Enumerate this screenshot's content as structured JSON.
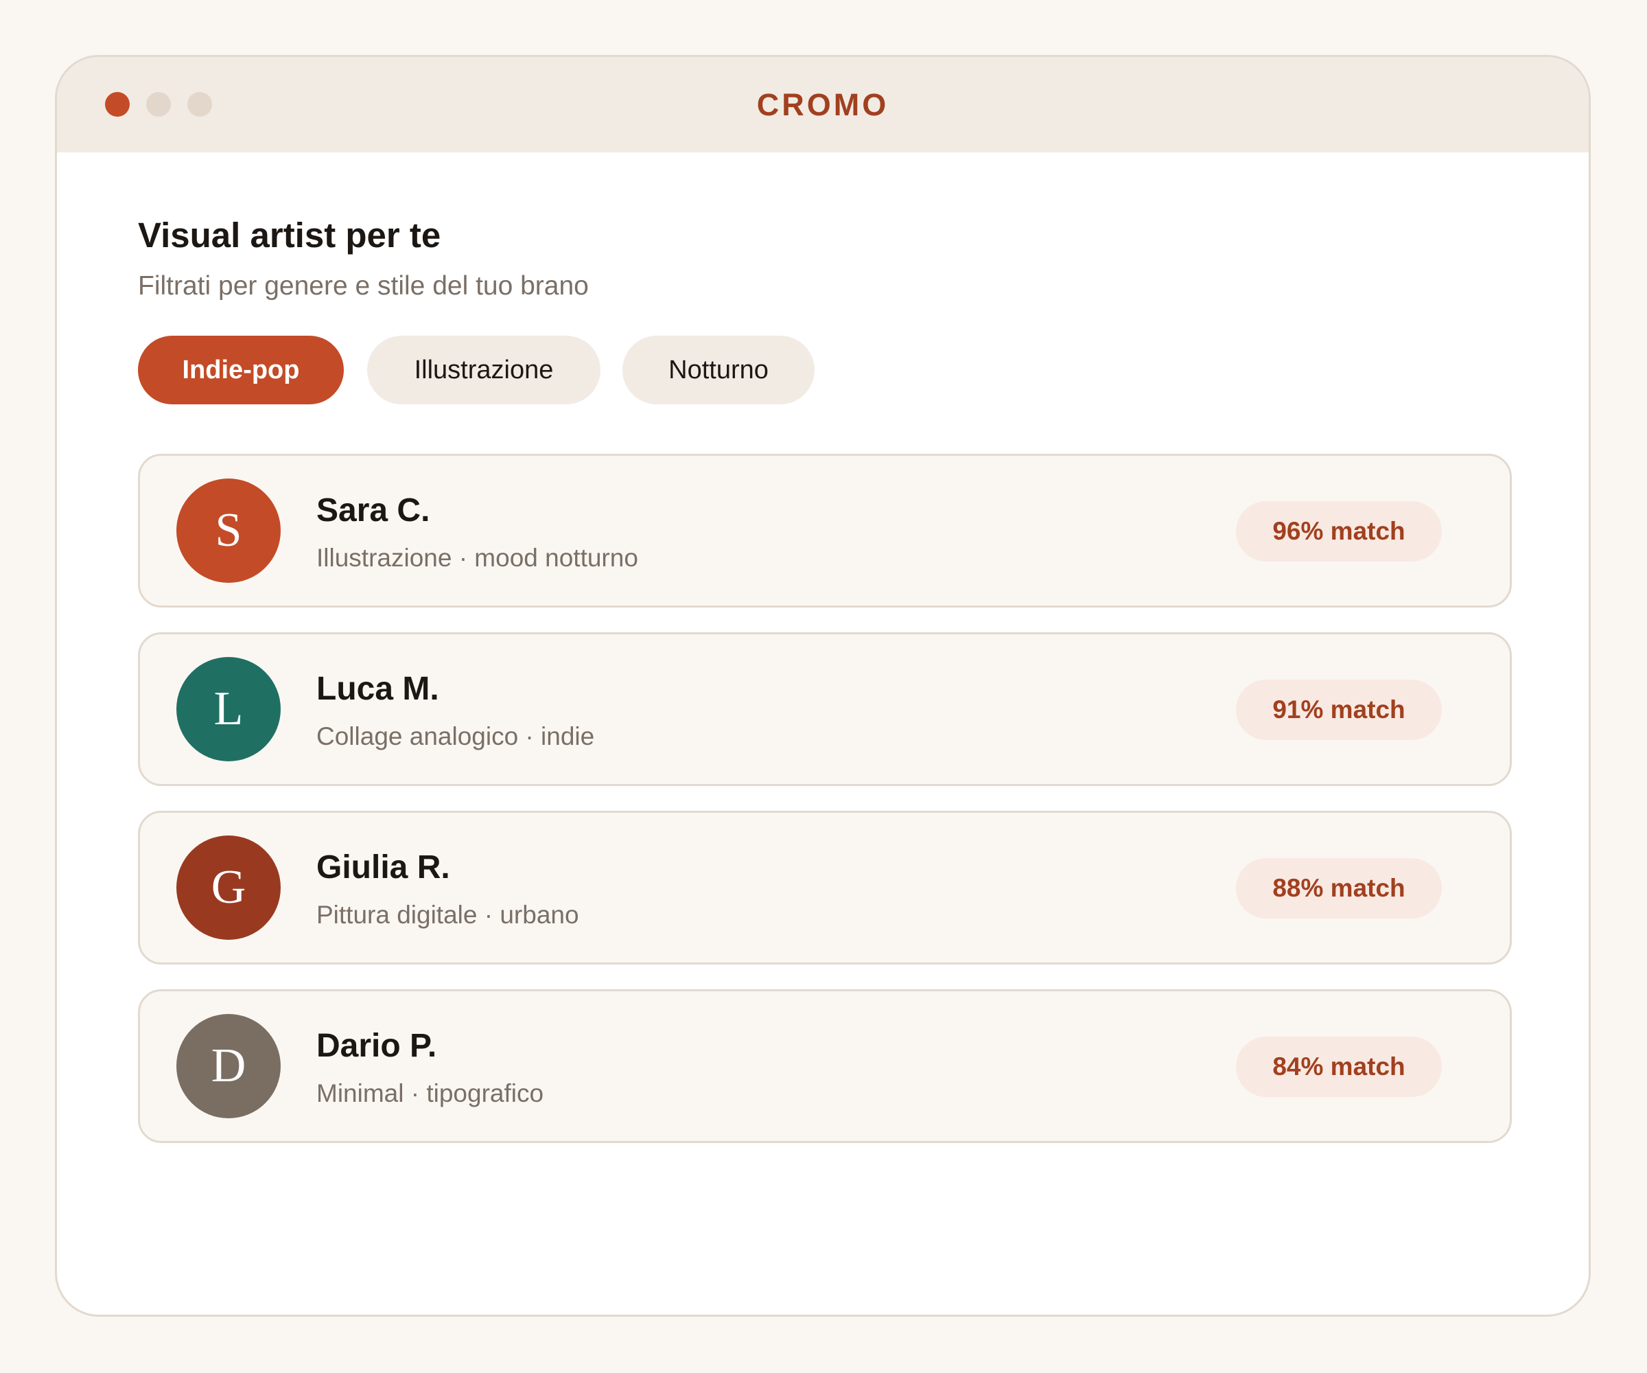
{
  "app": {
    "title": "CROMO"
  },
  "header": {
    "title": "Visual artist per te",
    "subtitle": "Filtrati per genere e stile del tuo brano"
  },
  "filters": [
    {
      "label": "Indie-pop",
      "active": true
    },
    {
      "label": "Illustrazione",
      "active": false
    },
    {
      "label": "Notturno",
      "active": false
    }
  ],
  "artists": [
    {
      "initial": "S",
      "name": "Sara C.",
      "meta": "Illustrazione · mood notturno",
      "match": "96% match",
      "color": "#c44b27"
    },
    {
      "initial": "L",
      "name": "Luca M.",
      "meta": "Collage analogico · indie",
      "match": "91% match",
      "color": "#1f7063"
    },
    {
      "initial": "G",
      "name": "Giulia R.",
      "meta": "Pittura digitale · urbano",
      "match": "88% match",
      "color": "#993a20"
    },
    {
      "initial": "D",
      "name": "Dario P.",
      "meta": "Minimal · tipografico",
      "match": "84% match",
      "color": "#7a6e62"
    }
  ],
  "colors": {
    "accent": "#c44b27",
    "accent_text": "#a1401f",
    "background": "#faf7f2"
  }
}
